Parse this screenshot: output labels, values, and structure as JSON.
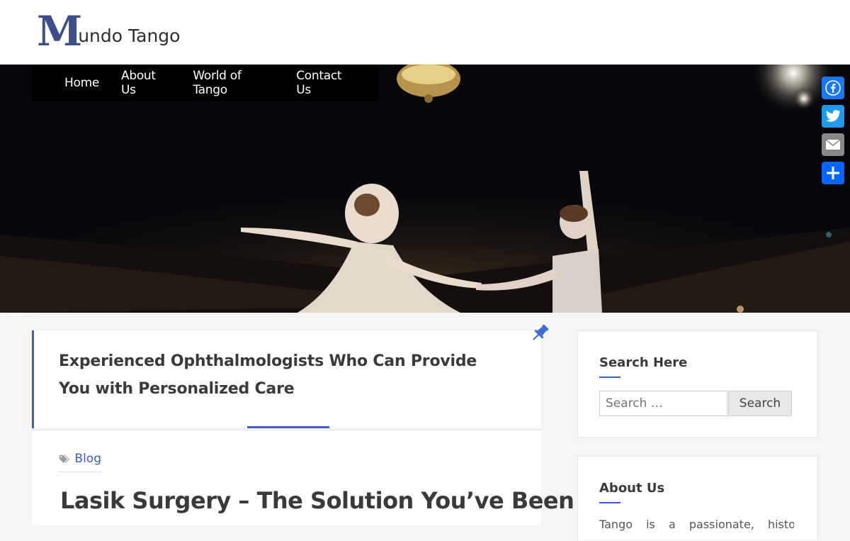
{
  "site": {
    "logo_initial": "M",
    "logo_rest": "undo Tango",
    "brand_color": "#3d4f8a",
    "accent_color": "#3d5fc4"
  },
  "nav": {
    "items": [
      {
        "label": "Home"
      },
      {
        "label": "About Us"
      },
      {
        "label": "World of Tango"
      },
      {
        "label": "Contact Us"
      }
    ]
  },
  "share": {
    "buttons": [
      {
        "name": "Facebook",
        "icon": "facebook-icon",
        "color": "#1877f2"
      },
      {
        "name": "Twitter",
        "icon": "twitter-icon",
        "color": "#1d9bf0"
      },
      {
        "name": "Email",
        "icon": "email-icon",
        "color": "#888888"
      },
      {
        "name": "Share",
        "icon": "plus-icon",
        "color": "#0166ff"
      }
    ]
  },
  "hero": {
    "image": "ballet-dancers-on-stage"
  },
  "featured": {
    "title": "Experienced Ophthalmologists Who Can Provide You with Personalized Care",
    "pinned_icon": "pin-icon"
  },
  "post": {
    "category": "Blog",
    "category_icon": "tags-icon",
    "title": "Lasik Surgery – The Solution You’ve Been"
  },
  "sidebar": {
    "search_widget": {
      "title": "Search Here",
      "placeholder": "Search …",
      "button_label": "Search"
    },
    "about_widget": {
      "title": "About Us",
      "text": "Tango is a passionate, historical"
    }
  }
}
